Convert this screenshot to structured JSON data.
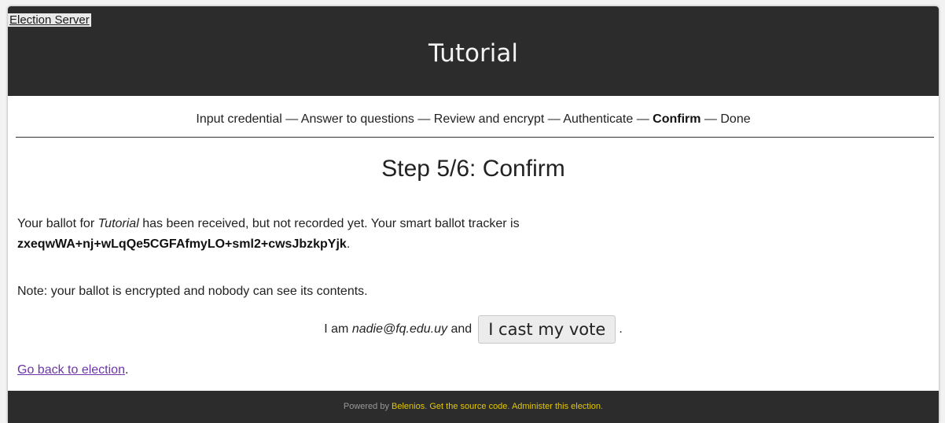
{
  "header": {
    "server_link": "Election Server",
    "title": "Tutorial"
  },
  "steps": {
    "items": [
      "Input credential",
      "Answer to questions",
      "Review and encrypt",
      "Authenticate",
      "Confirm",
      "Done"
    ],
    "separator": " — ",
    "current_index": 4
  },
  "main": {
    "heading": "Step 5/6: Confirm",
    "received_prefix": "Your ballot for ",
    "election_name": "Tutorial",
    "received_suffix": " has been received, but not recorded yet. Your smart ballot tracker is",
    "tracker": "zxeqwWA+nj+wLqQe5CGFAfmyLO+sml2+cwsJbzkpYjk",
    "tracker_end": ".",
    "note": "Note: your ballot is encrypted and nobody can see its contents.",
    "iam_prefix": "I am ",
    "voter_email": "nadie@fq.edu.uy",
    "iam_and": " and ",
    "cast_button": "I cast my vote",
    "cast_end": ".",
    "go_back_link": "Go back to election",
    "go_back_end": "."
  },
  "footer": {
    "powered_by": "Powered by ",
    "belenios_link": "Belenios",
    "sep1": ". ",
    "source_link": "Get the source code",
    "sep2": ". ",
    "admin_link": "Administer this election",
    "end": "."
  },
  "colors": {
    "header_bg": "#2c2c2c",
    "link_visited": "#6b34a8",
    "footer_link": "#e3c800"
  }
}
